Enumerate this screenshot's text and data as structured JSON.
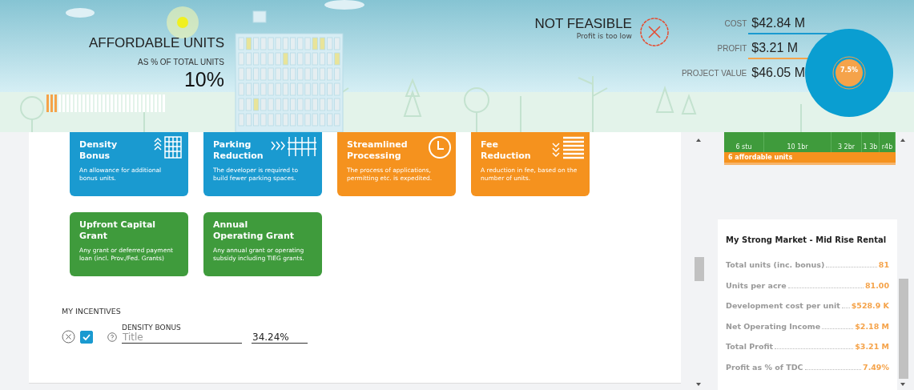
{
  "header": {
    "affordable": {
      "title": "AFFORDABLE UNITS",
      "subtitle": "AS % OF TOTAL UNITS",
      "value": "10%",
      "level": 0.1
    },
    "feasibility": {
      "status": "NOT FEASIBLE",
      "note": "Profit is too low",
      "feasible": false
    },
    "metrics": [
      {
        "label": "COST",
        "value": "$42.84 M",
        "color": "#1a9ad0"
      },
      {
        "label": "PROFIT",
        "value": "$3.21 M",
        "color": "#f5a34a"
      },
      {
        "label": "PROJECT VALUE",
        "value": "$46.05 M"
      }
    ],
    "pie_label": "7.5%"
  },
  "incentives": [
    {
      "title": "Density Bonus",
      "desc": "An allowance for additional bonus units.",
      "color": "#1a9ad0",
      "kind": "density"
    },
    {
      "title": "Parking Reduction",
      "desc": "The developer is required to build fewer parking spaces.",
      "color": "#1a9ad0",
      "kind": "parking"
    },
    {
      "title": "Streamlined Processing",
      "desc": "The process of applications, permitting etc. is expedited.",
      "color": "#f5921e",
      "kind": "clock"
    },
    {
      "title": "Fee Reduction",
      "desc": "A reduction in fee, based on the number of units.",
      "color": "#f5921e",
      "kind": "fee"
    },
    {
      "title": "Upfront Capital Grant",
      "desc": "Any grant or deferred payment loan (incl. Prov./Fed. Grants)",
      "color": "#3f9b3c",
      "kind": "none"
    },
    {
      "title": "Annual Operating Grant",
      "desc": "Any annual grant or operating subsidy including TIEG grants.",
      "color": "#3f9b3c",
      "kind": "none"
    }
  ],
  "my_incentives": {
    "heading": "MY INCENTIVES",
    "items": [
      {
        "label": "DENSITY BONUS",
        "checked": true,
        "placeholder": "Title",
        "value": "34.24%"
      }
    ]
  },
  "unit_mix": {
    "segments": [
      {
        "label": "6 stu"
      },
      {
        "label": "10 1br"
      },
      {
        "label": "3 2br"
      },
      {
        "label": "1 3b"
      },
      {
        "label": "r4b"
      }
    ],
    "affordable": "6 affordable units"
  },
  "summary": {
    "title": "My Strong Market - Mid Rise Rental",
    "rows": [
      {
        "label": "Total units (inc. bonus)",
        "value": "81"
      },
      {
        "label": "Units per acre",
        "value": "81.00"
      },
      {
        "label": "Development cost per unit",
        "value": "$528.9 K"
      },
      {
        "label": "Net Operating Income",
        "value": "$2.18 M"
      },
      {
        "label": "Total Profit",
        "value": "$3.21 M"
      },
      {
        "label": "Profit as % of TDC",
        "value": "7.49%"
      }
    ]
  }
}
